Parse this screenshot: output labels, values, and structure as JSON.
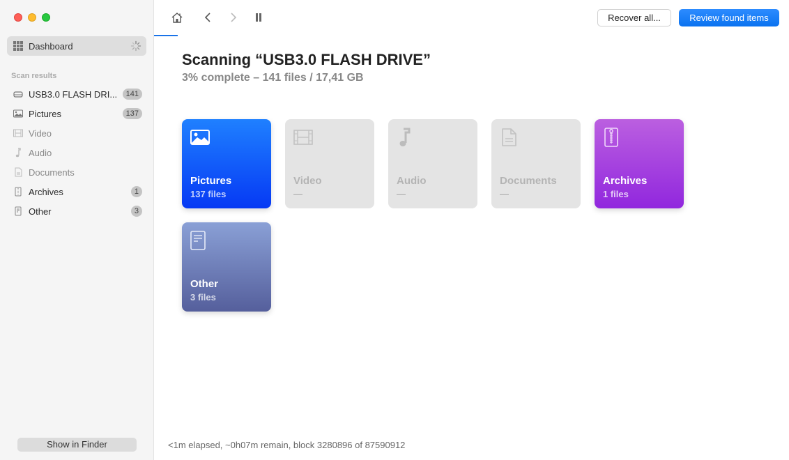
{
  "window": {
    "traffic_lights": [
      "close",
      "minimize",
      "zoom"
    ]
  },
  "sidebar": {
    "dashboard_label": "Dashboard",
    "section_label": "Scan results",
    "items": [
      {
        "label": "USB3.0 FLASH DRI...",
        "icon": "drive-icon",
        "badge": "141",
        "dim": false
      },
      {
        "label": "Pictures",
        "icon": "picture-icon",
        "badge": "137",
        "dim": false
      },
      {
        "label": "Video",
        "icon": "film-icon",
        "badge": null,
        "dim": true
      },
      {
        "label": "Audio",
        "icon": "music-note-icon",
        "badge": null,
        "dim": true
      },
      {
        "label": "Documents",
        "icon": "document-icon",
        "badge": null,
        "dim": true
      },
      {
        "label": "Archives",
        "icon": "archive-icon",
        "badge": "1",
        "dim": false
      },
      {
        "label": "Other",
        "icon": "other-file-icon",
        "badge": "3",
        "dim": false
      }
    ],
    "show_in_finder": "Show in Finder"
  },
  "toolbar": {
    "recover_all": "Recover all...",
    "review_found": "Review found items"
  },
  "main": {
    "title": "Scanning “USB3.0 FLASH DRIVE”",
    "subtitle": "3% complete – 141 files / 17,41 GB",
    "progress_percent": 3,
    "cards": [
      {
        "name": "Pictures",
        "count": "137 files"
      },
      {
        "name": "Video",
        "count": "—"
      },
      {
        "name": "Audio",
        "count": "—"
      },
      {
        "name": "Documents",
        "count": "—"
      },
      {
        "name": "Archives",
        "count": "1 files"
      },
      {
        "name": "Other",
        "count": "3 files"
      }
    ],
    "status": "<1m elapsed, ~0h07m remain, block 3280896 of 87590912"
  },
  "colors": {
    "accent": "#0a72f0",
    "pictures": "#1f80ff",
    "archives": "#9127de",
    "other": "#555f9c"
  }
}
